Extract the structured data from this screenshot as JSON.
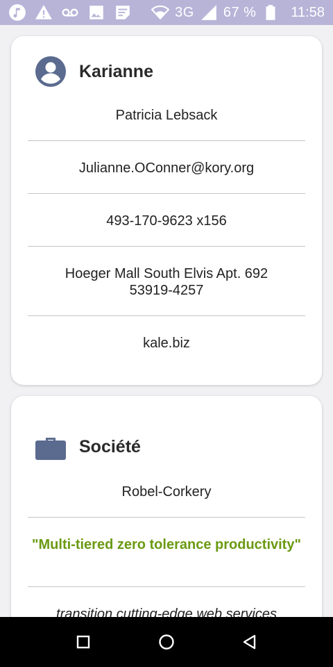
{
  "status_bar": {
    "battery_percent": "67 %",
    "network": "3G",
    "time": "11:58",
    "icons": [
      "music-icon",
      "alert-icon",
      "voicemail-icon",
      "image-icon",
      "notes-icon",
      "wifi-icon",
      "signal-icon",
      "battery-icon"
    ]
  },
  "contact_card": {
    "title": "Karianne",
    "icon": "account-circle-icon",
    "name": "Patricia Lebsack",
    "email": "Julianne.OConner@kory.org",
    "phone": "493-170-9623 x156",
    "address_line1": "Hoeger Mall South Elvis Apt. 692",
    "address_line2": "53919-4257",
    "website": "kale.biz"
  },
  "company_card": {
    "title": "Société",
    "icon": "briefcase-icon",
    "name": "Robel-Corkery",
    "catch_phrase": "\"Multi-tiered zero tolerance productivity\"",
    "bs": "transition cutting-edge web services"
  },
  "colors": {
    "status_bar": "#b7b4d8",
    "icon_accent": "#5b6a8f",
    "slogan": "#6a9a12"
  },
  "nav_bar": {
    "buttons": [
      "recents-square-icon",
      "home-circle-icon",
      "back-triangle-icon"
    ]
  }
}
